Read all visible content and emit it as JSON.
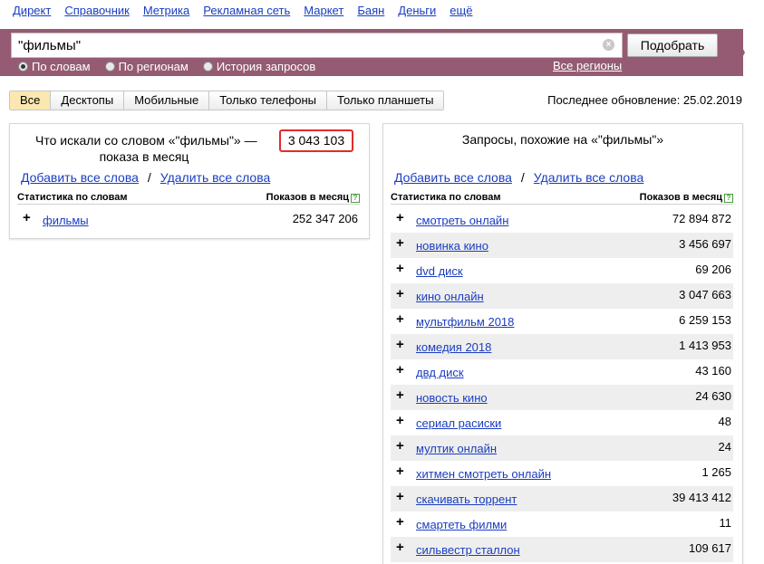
{
  "topnav": [
    "Директ",
    "Справочник",
    "Метрика",
    "Рекламная сеть",
    "Маркет",
    "Баян",
    "Деньги",
    "ещё"
  ],
  "search": {
    "value": "\"фильмы\"",
    "clear_icon": "×",
    "button_label": "Подобрать",
    "radios": [
      {
        "label": "По словам",
        "checked": true
      },
      {
        "label": "По регионам",
        "checked": false
      },
      {
        "label": "История запросов",
        "checked": false
      }
    ],
    "regions_link": "Все регионы"
  },
  "device_tabs": [
    {
      "label": "Все",
      "active": true
    },
    {
      "label": "Десктопы",
      "active": false
    },
    {
      "label": "Мобильные",
      "active": false
    },
    {
      "label": "Только телефоны",
      "active": false
    },
    {
      "label": "Только планшеты",
      "active": false
    }
  ],
  "last_update": "Последнее обновление: 25.02.2019",
  "left_panel": {
    "title_line1": "Что искали со словом «\"фильмы\"» —",
    "title_line2": "показа в месяц",
    "total": "3 043 103",
    "add_all": "Добавить все слова",
    "divider": "/",
    "remove_all": "Удалить все слова",
    "col_words": "Статистика по словам",
    "col_shows": "Показов в месяц",
    "help_icon": "?",
    "rows": [
      {
        "plus": "+",
        "phrase": "фильмы",
        "count": "252 347 206"
      }
    ]
  },
  "right_panel": {
    "title": "Запросы, похожие на «\"фильмы\"»",
    "add_all": "Добавить все слова",
    "divider": "/",
    "remove_all": "Удалить все слова",
    "col_words": "Статистика по словам",
    "col_shows": "Показов в месяц",
    "help_icon": "?",
    "rows": [
      {
        "plus": "+",
        "phrase": "смотреть онлайн",
        "count": "72 894 872"
      },
      {
        "plus": "+",
        "phrase": "новинка кино",
        "count": "3 456 697"
      },
      {
        "plus": "+",
        "phrase": "dvd диск",
        "count": "69 206"
      },
      {
        "plus": "+",
        "phrase": "кино онлайн",
        "count": "3 047 663"
      },
      {
        "plus": "+",
        "phrase": "мультфильм 2018",
        "count": "6 259 153"
      },
      {
        "plus": "+",
        "phrase": "комедия 2018",
        "count": "1 413 953"
      },
      {
        "plus": "+",
        "phrase": "двд диск",
        "count": "43 160"
      },
      {
        "plus": "+",
        "phrase": "новость кино",
        "count": "24 630"
      },
      {
        "plus": "+",
        "phrase": "сериал расиски",
        "count": "48"
      },
      {
        "plus": "+",
        "phrase": "мултик онлайн",
        "count": "24"
      },
      {
        "plus": "+",
        "phrase": "хитмен смотреть онлайн",
        "count": "1 265"
      },
      {
        "plus": "+",
        "phrase": "скачивать торрент",
        "count": "39 413 412"
      },
      {
        "plus": "+",
        "phrase": "смартеть филми",
        "count": "11"
      },
      {
        "plus": "+",
        "phrase": "сильвестр сталлон",
        "count": "109 617"
      }
    ]
  },
  "colors": {
    "band": "#955b73",
    "link": "#1a3dc1",
    "highlight": "#e12c2c",
    "active_tab": "#fbe8b0"
  }
}
